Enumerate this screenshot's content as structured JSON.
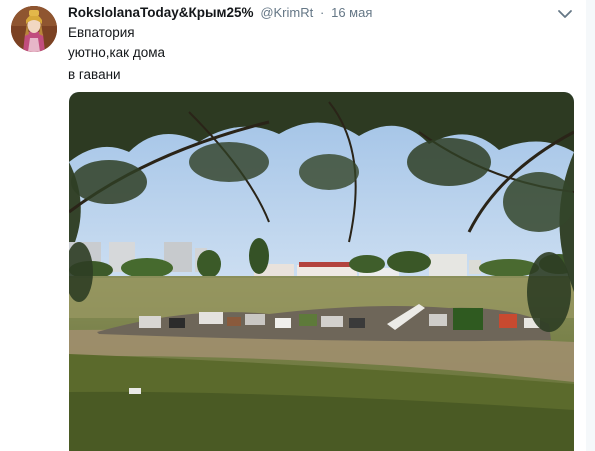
{
  "tweet": {
    "author_name": "RokslolanaToday&Крым25%",
    "handle": "@KrimRt",
    "separator": "·",
    "date": "16 мая",
    "text_lines": [
      "Евпатория",
      "уютно,как дома",
      "в гавани"
    ]
  },
  "icons": {
    "menu": "chevron-down-icon"
  },
  "colors": {
    "name": "#14171a",
    "secondary": "#657786",
    "sky": "#a9c8ea",
    "grass": "#6f7c3c"
  }
}
